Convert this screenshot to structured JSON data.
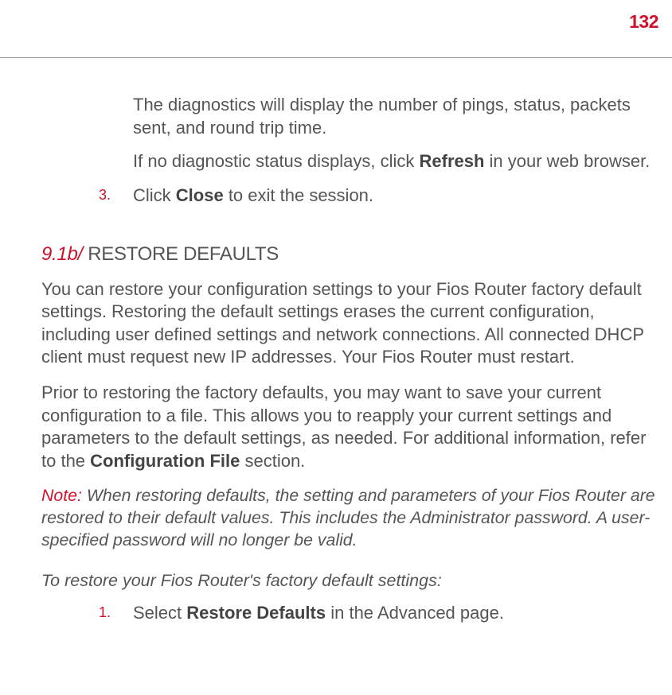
{
  "page_number": "132",
  "intro": {
    "p1": "The diagnostics will display the number of pings, status, packets sent, and round trip time.",
    "p2_pre": "If no diagnostic status displays, click ",
    "p2_bold": "Refresh",
    "p2_post": " in your web browser."
  },
  "step3": {
    "num": "3.",
    "pre": "Click ",
    "bold": "Close",
    "post": " to exit the session."
  },
  "section": {
    "num": "9.1b/",
    "title": " RESTORE DEFAULTS"
  },
  "restore_p1": "You can restore your configuration settings to your Fios Router factory default settings. Restoring the default settings erases the current configuration, including user defined settings and network connections. All connected DHCP client must request new IP addresses. Your Fios Router must restart.",
  "restore_p2_pre": "Prior to restoring the factory defaults, you may want to save your current configuration to a file. This allows you to reapply your current settings and parameters to the default settings, as needed. For additional information, refer to the ",
  "restore_p2_bold": "Configuration File",
  "restore_p2_post": " section.",
  "note": {
    "label": "Note:",
    "text": " When restoring defaults, the setting and parameters of your Fios Router are restored to their default values. This includes the Administrator password. A user-specified password will no longer be valid."
  },
  "restore_lead": "To restore your Fios Router's factory default settings:",
  "step1": {
    "num": "1.",
    "pre": "Select ",
    "bold": "Restore Defaults",
    "post": " in the Advanced page."
  }
}
